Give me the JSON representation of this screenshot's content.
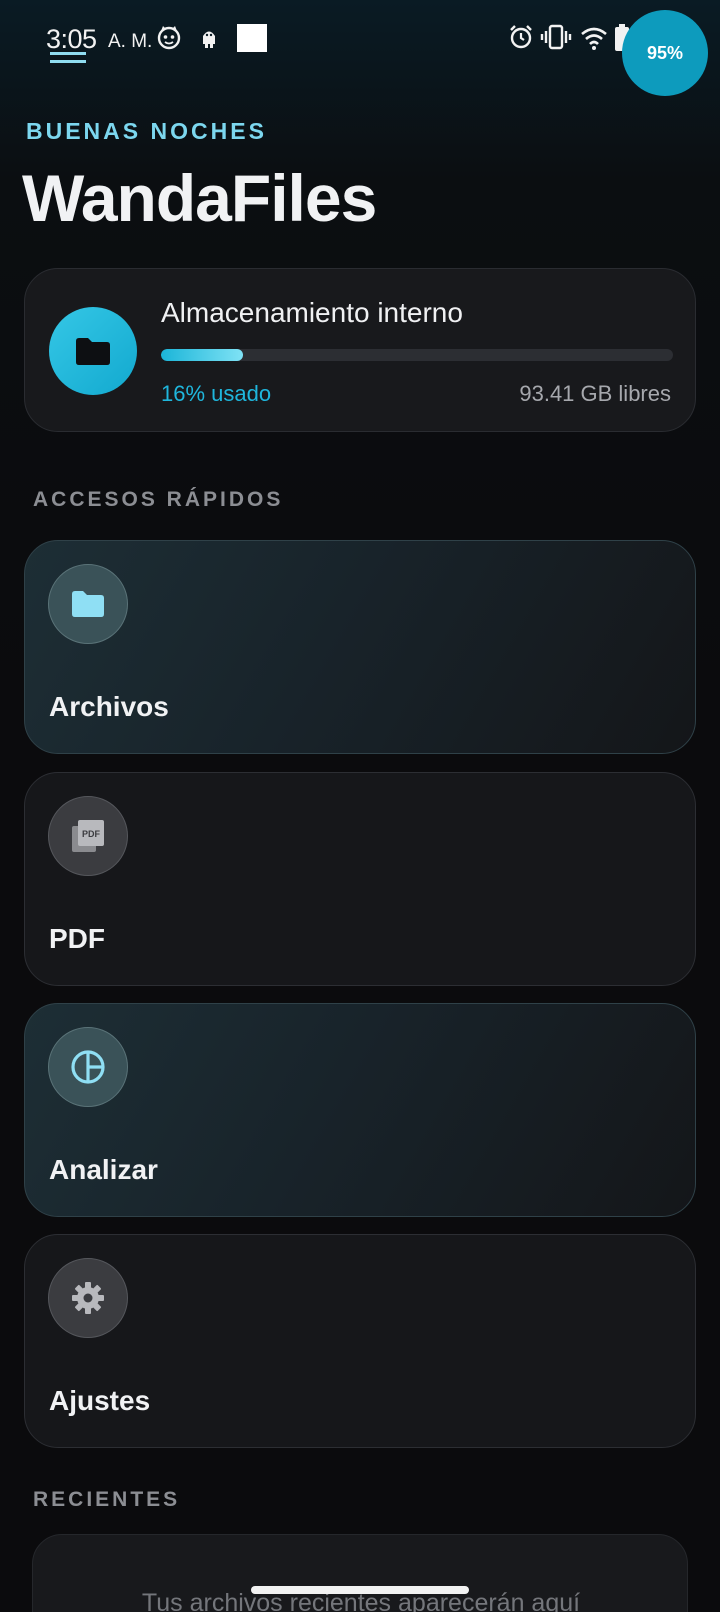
{
  "status_bar": {
    "time": "3:05",
    "ampm": "A. M.",
    "battery": "95%",
    "icons": [
      "cat-face-icon",
      "android-icon",
      "white-square-icon",
      "alarm-icon",
      "vibrate-icon",
      "wifi-icon",
      "battery-icon"
    ]
  },
  "header": {
    "greeting": "BUENAS NOCHES",
    "title": "WandaFiles"
  },
  "storage": {
    "title": "Almacenamiento interno",
    "used_label": "16% usado",
    "used_fraction": 0.16,
    "free_label": "93.41 GB libres",
    "icon": "folder-icon"
  },
  "quick_access": {
    "label": "ACCESOS RÁPIDOS",
    "items": [
      {
        "label": "Archivos",
        "icon": "folder-icon"
      },
      {
        "label": "PDF",
        "icon": "pdf-icon"
      },
      {
        "label": "Analizar",
        "icon": "pie-chart-icon"
      },
      {
        "label": "Ajustes",
        "icon": "gear-icon"
      }
    ]
  },
  "recents": {
    "label": "RECIENTES",
    "empty_text": "Tus archivos recientes aparecerán aquí"
  },
  "colors": {
    "accent": "#1fb6dc",
    "background": "#0b0b0d",
    "card": "#18191c"
  }
}
